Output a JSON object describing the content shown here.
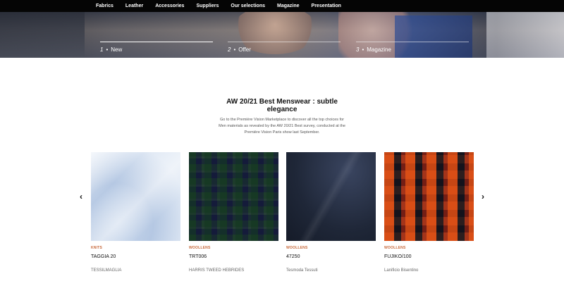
{
  "nav": {
    "items": [
      {
        "label": "Fabrics"
      },
      {
        "label": "Leather"
      },
      {
        "label": "Accessories"
      },
      {
        "label": "Suppliers"
      },
      {
        "label": "Our selections"
      },
      {
        "label": "Magazine"
      },
      {
        "label": "Presentation"
      }
    ]
  },
  "hero": {
    "tabs": [
      {
        "num": "1",
        "dot": "•",
        "label": "New"
      },
      {
        "num": "2",
        "dot": "•",
        "label": "Offer"
      },
      {
        "num": "3",
        "dot": "•",
        "label": "Magazine"
      }
    ]
  },
  "section": {
    "title": "AW 20/21 Best Menswear : subtle elegance",
    "description": "Go to the Première Vision Marketplace to discover all the top choices for Men materials as revealed by the AW 20/21 Best survey, conducted at the Première Vision Paris show last September."
  },
  "carousel": {
    "prev_icon": "chevron-left-icon",
    "next_icon": "chevron-right-icon",
    "prev_glyph": "‹",
    "next_glyph": "›",
    "cards": [
      {
        "category": "KNITS",
        "name": "TAGGIA 20",
        "maker": "TESSILMAGLIA"
      },
      {
        "category": "WOOLLENS",
        "name": "TRT006",
        "maker": "HARRIS TWEED HEBRIDES"
      },
      {
        "category": "WOOLLENS",
        "name": "47250",
        "maker": "Tesmoda Tessuti"
      },
      {
        "category": "WOOLLENS",
        "name": "FUJIKO/100",
        "maker": "Lanificio Bisentino"
      }
    ]
  },
  "colors": {
    "nav_bg": "#050505",
    "category_accent": "#c86a3c"
  }
}
